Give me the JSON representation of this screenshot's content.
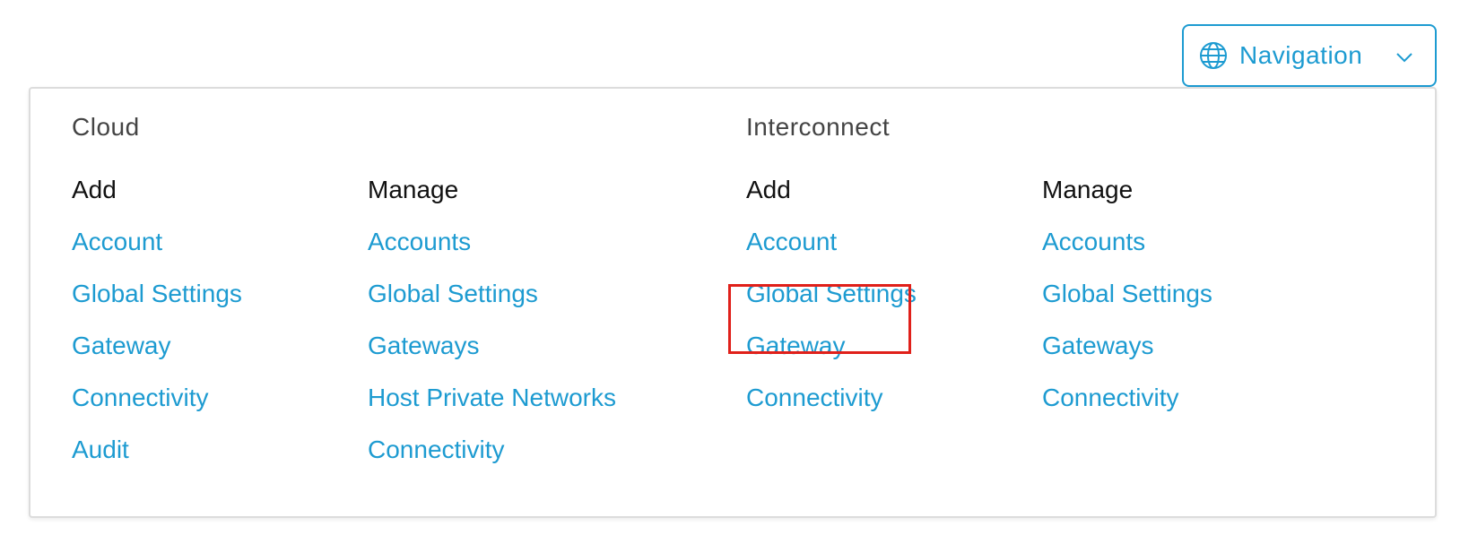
{
  "navigation_button": {
    "label": "Navigation",
    "icon": "globe-icon",
    "caret_icon": "chevron-down-icon"
  },
  "colors": {
    "link": "#1d9bd1",
    "highlight": "#e0201a",
    "panel_border": "#dcdcdc"
  },
  "sections": {
    "cloud": {
      "title": "Cloud",
      "add": {
        "heading": "Add",
        "items": [
          "Account",
          "Global Settings",
          "Gateway",
          "Connectivity",
          "Audit"
        ]
      },
      "manage": {
        "heading": "Manage",
        "items": [
          "Accounts",
          "Global Settings",
          "Gateways",
          "Host Private Networks",
          "Connectivity"
        ]
      }
    },
    "interconnect": {
      "title": "Interconnect",
      "add": {
        "heading": "Add",
        "items": [
          "Account",
          "Global Settings",
          "Gateway",
          "Connectivity"
        ]
      },
      "manage": {
        "heading": "Manage",
        "items": [
          "Accounts",
          "Global Settings",
          "Gateways",
          "Connectivity"
        ]
      }
    }
  }
}
